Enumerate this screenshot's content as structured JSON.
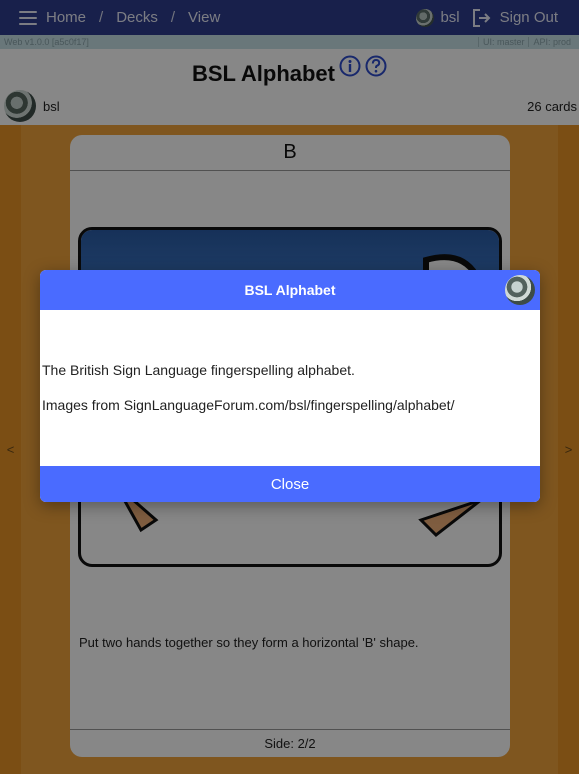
{
  "nav": {
    "breadcrumbs": [
      "Home",
      "Decks",
      "View"
    ],
    "separator": "/",
    "username": "bsl",
    "signout_label": "Sign Out"
  },
  "version": {
    "left": "Web v1.0.0 [a5c0f17]",
    "ui": "UI: master",
    "api": "API: prod"
  },
  "deck": {
    "title": "BSL Alphabet",
    "owner": "bsl",
    "card_count": "26 cards"
  },
  "card": {
    "heading": "B",
    "description": "Put two hands together so they form a horizontal 'B' shape.",
    "side": "Side: 2/2",
    "prev_arrow": "<",
    "next_arrow": ">"
  },
  "modal": {
    "title": "BSL Alphabet",
    "lines": [
      "The British Sign Language fingerspelling alphabet.",
      "Images from SignLanguageForum.com/bsl/fingerspelling/alphabet/"
    ],
    "close_label": "Close"
  },
  "colors": {
    "nav_bg": "#2e3d8f",
    "stage_orange": "#f0a23b",
    "modal_accent": "#4a6bff"
  },
  "icons": {
    "menu": "hamburger-icon",
    "signout": "sign-out-icon",
    "info": "info-icon",
    "help": "help-icon"
  }
}
